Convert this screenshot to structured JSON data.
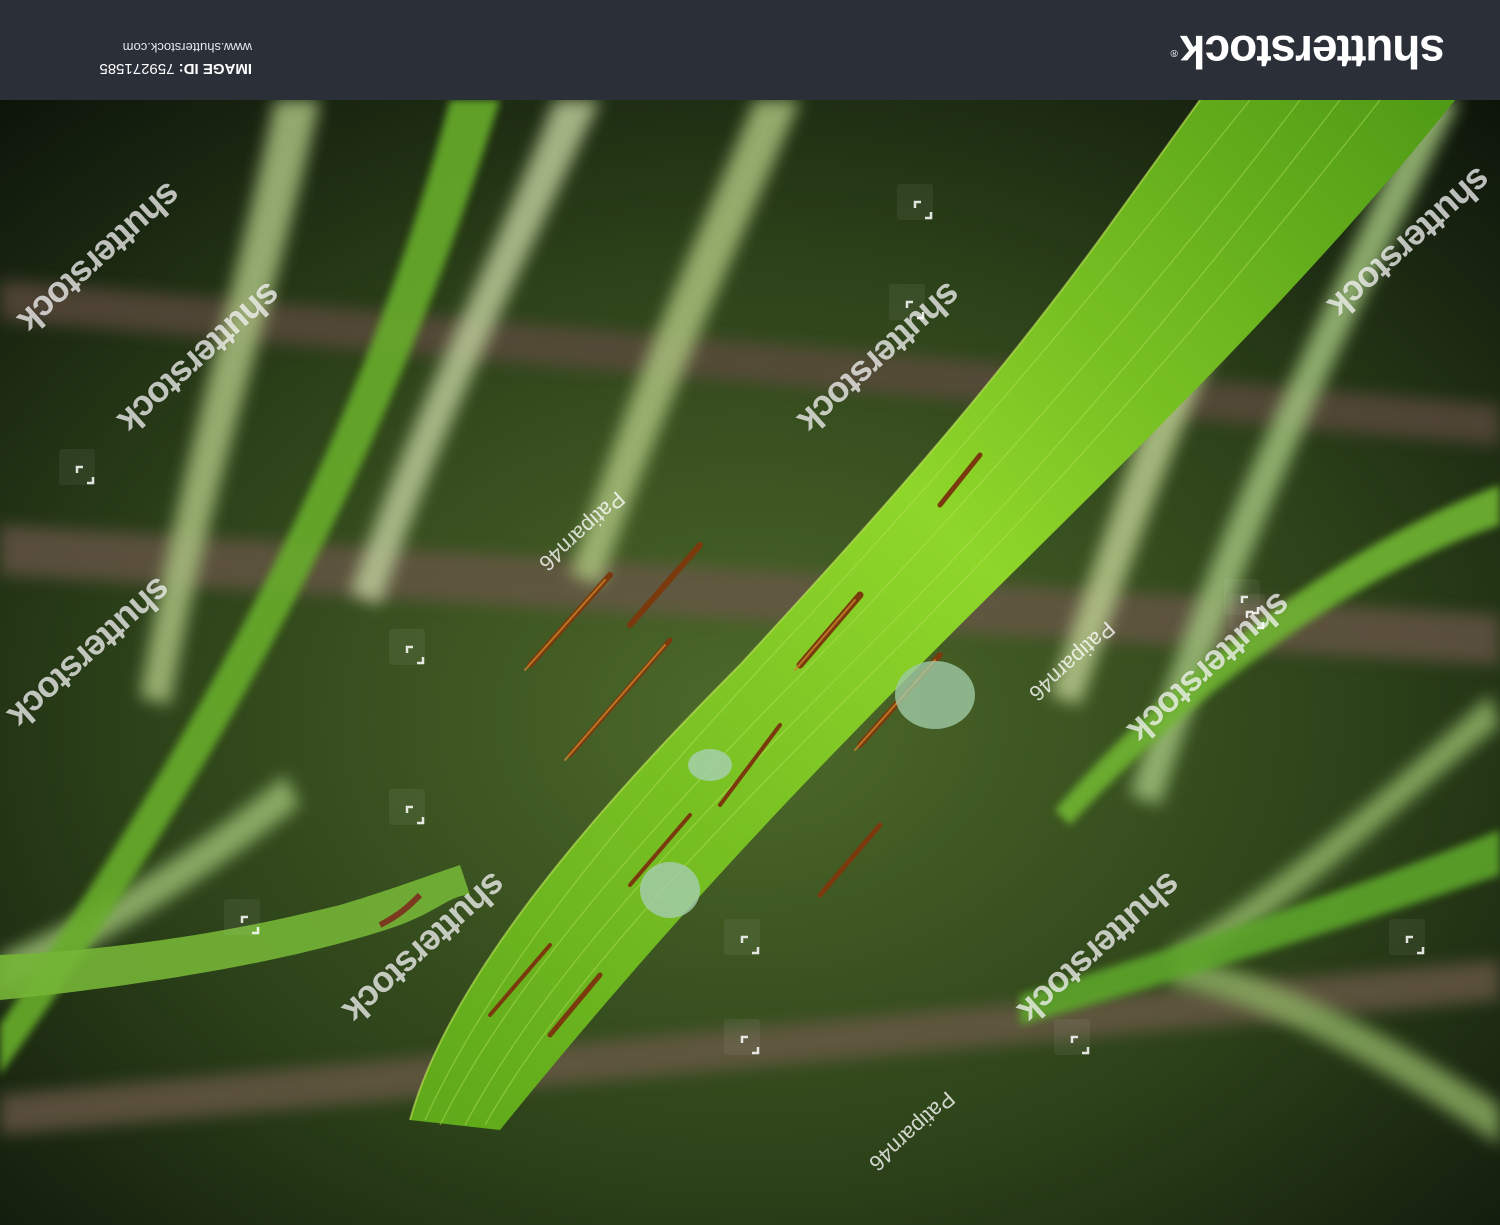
{
  "footer": {
    "logo_text": "shutterstock",
    "logo_mark": "®",
    "image_id_label": "IMAGE ID:",
    "image_id": "759271585",
    "site_url": "www.shutterstock.com",
    "background": "#2a2f38"
  },
  "watermarks": {
    "brand": "shutterstock",
    "contributor": "Patiparn46",
    "icon": "shutterstock-corner-icon"
  },
  "photo": {
    "subject": "rice-leaf-with-disease-spots",
    "colors": {
      "leaf": "#8fd62a",
      "leaf_dark": "#4f9a15",
      "lesion": "#7a3a0d",
      "background": "#22361a"
    }
  }
}
